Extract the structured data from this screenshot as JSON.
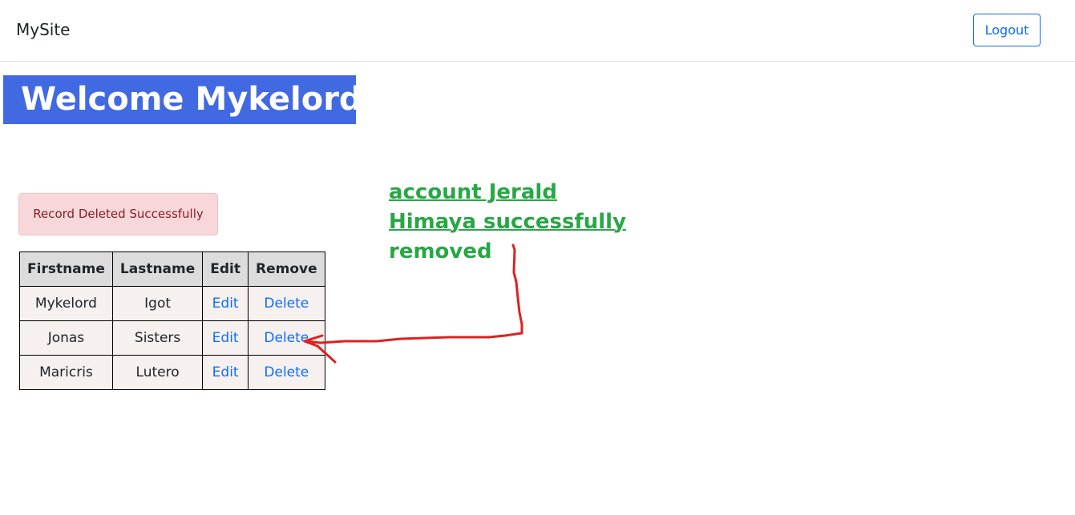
{
  "navbar": {
    "brand": "MySite",
    "logout_label": "Logout"
  },
  "heading": {
    "welcome": "Welcome Mykelord",
    "background_color": "#4169e1"
  },
  "alert": {
    "message": "Record Deleted Successfully",
    "background_color": "#f8d7da"
  },
  "table": {
    "columns": [
      "Firstname",
      "Lastname",
      "Edit",
      "Remove"
    ],
    "rows": [
      {
        "firstname": "Mykelord",
        "lastname": "Igot",
        "edit": "Edit",
        "remove": "Delete"
      },
      {
        "firstname": "Jonas",
        "lastname": "Sisters",
        "edit": "Edit",
        "remove": "Delete"
      },
      {
        "firstname": "Maricris",
        "lastname": "Lutero",
        "edit": "Edit",
        "remove": "Delete"
      }
    ]
  },
  "annotation": {
    "line1": "account Jerald",
    "line2": "Himaya successfully",
    "line3": "removed",
    "text_color": "#28a745",
    "arrow_color": "#e02020"
  }
}
